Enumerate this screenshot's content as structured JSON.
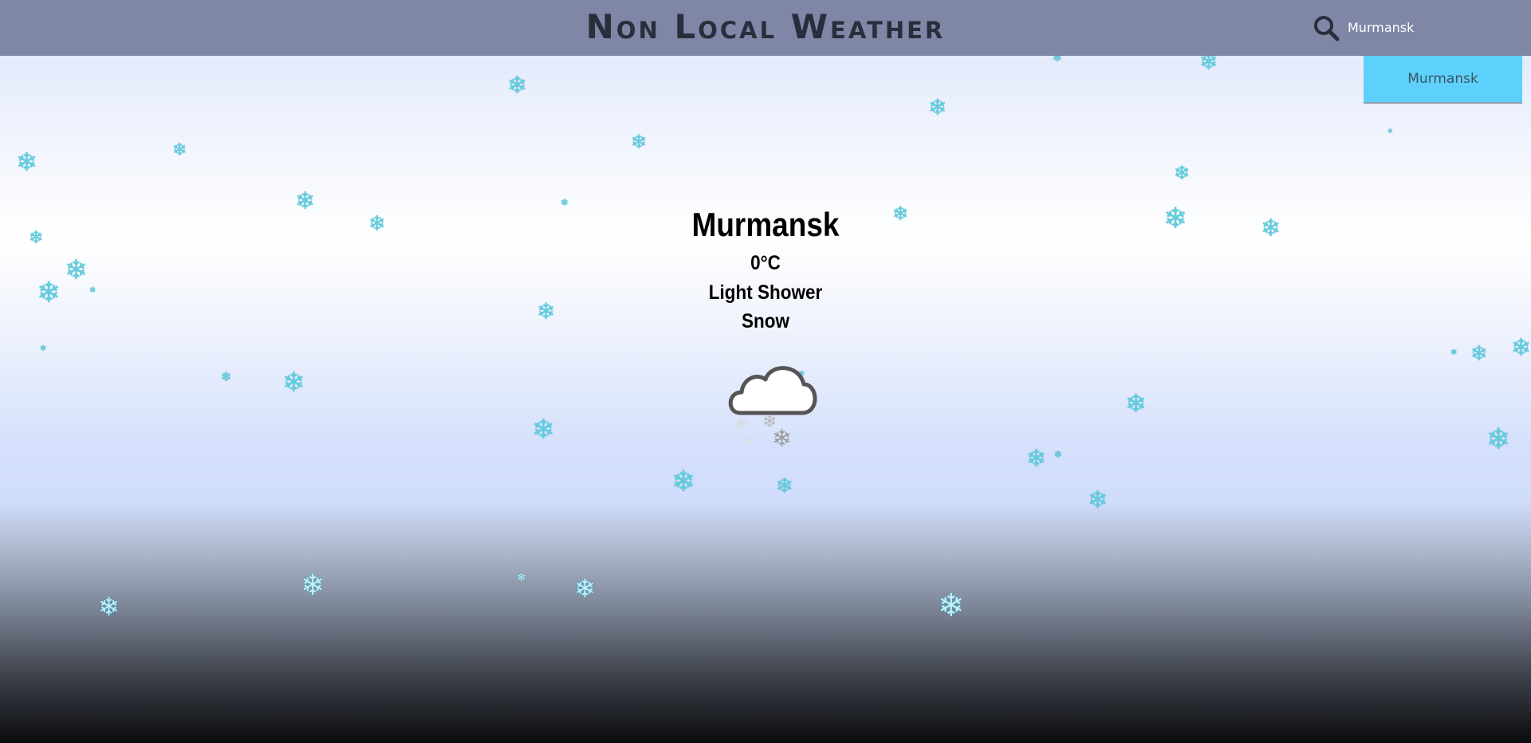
{
  "app": {
    "title": "Non Local Weather"
  },
  "search": {
    "value": "Murmansk",
    "icon": "search-icon",
    "suggestions": [
      "Murmansk"
    ]
  },
  "weather": {
    "city": "Murmansk",
    "temperature": "0°C",
    "condition": "Light Shower Snow",
    "icon": "cloud-snow-icon"
  },
  "theme": {
    "topbar_color": "#7f86a6",
    "suggestion_color": "#5dd1fb",
    "snowflake_color": "#5fcfe0",
    "title_color": "#2a2d3b"
  }
}
